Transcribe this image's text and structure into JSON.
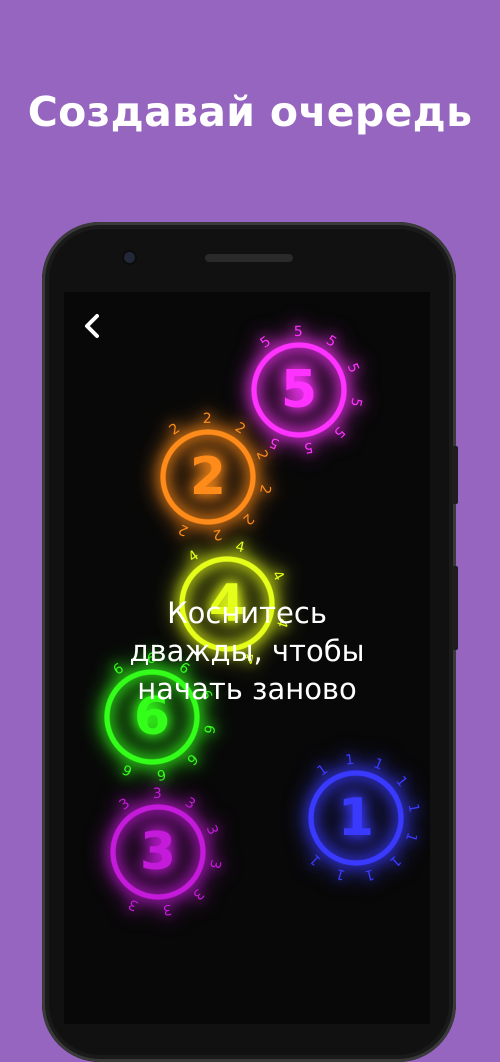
{
  "headline": "Создавай очередь",
  "back_label": "",
  "overlay": {
    "lines": [
      "Коснитесь",
      "дважды, чтобы",
      "начать заново"
    ]
  },
  "timers": [
    {
      "label": "5",
      "color": "#ff33ff",
      "marks": 8
    },
    {
      "label": "2",
      "color": "#ff8c1a",
      "marks": 8
    },
    {
      "label": "4",
      "color": "#e6ff1a",
      "marks": 5
    },
    {
      "label": "6",
      "color": "#33ff1a",
      "marks": 8
    },
    {
      "label": "3",
      "color": "#c41ad9",
      "marks": 8
    },
    {
      "label": "1",
      "color": "#3a3aff",
      "marks": 10
    }
  ],
  "colors": {
    "background": "#9565c0",
    "screen": "#080808",
    "text": "#ffffff"
  }
}
